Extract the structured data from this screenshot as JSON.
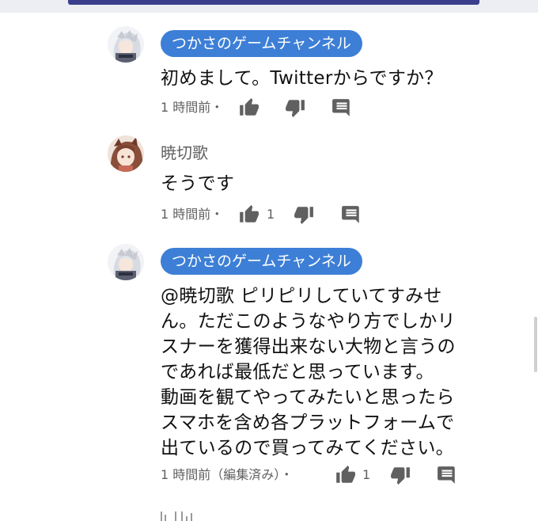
{
  "comments": [
    {
      "author": "つかさのゲームチャンネル",
      "author_style": "badge",
      "avatar": "avatar-silver-hair",
      "text": "初めまして。Twitterからですか？",
      "time": "1 時間前・",
      "likes": "",
      "icons": [
        "thumb-up-icon",
        "thumb-down-icon",
        "reply-icon"
      ]
    },
    {
      "author": "暁切歌",
      "author_style": "plain",
      "avatar": "avatar-brown-hair",
      "text": "そうです",
      "time": "1 時間前・",
      "likes": "1",
      "icons": [
        "thumb-up-icon",
        "thumb-down-icon",
        "reply-icon"
      ]
    },
    {
      "author": "つかさのゲームチャンネル",
      "author_style": "badge",
      "avatar": "avatar-silver-hair",
      "text_lines": [
        "@暁切歌 ピリピリしていてすみせ",
        "ん。ただこのようなやり方でしかリ",
        "スナーを獲得出来ない大物と言うの",
        "であれば最低だと思っています。",
        "動画を観てやってみたいと思ったら",
        "スマホを含め各プラットフォームで",
        "出ているので買ってみてください。"
      ],
      "time": "1 時間前（編集済み）・",
      "likes": "1",
      "icons": [
        "thumb-up-icon",
        "thumb-down-icon",
        "reply-icon"
      ]
    }
  ],
  "colors": {
    "badge_bg": "#3d7fd6",
    "icon": "#606060",
    "meta_text": "#606060"
  }
}
